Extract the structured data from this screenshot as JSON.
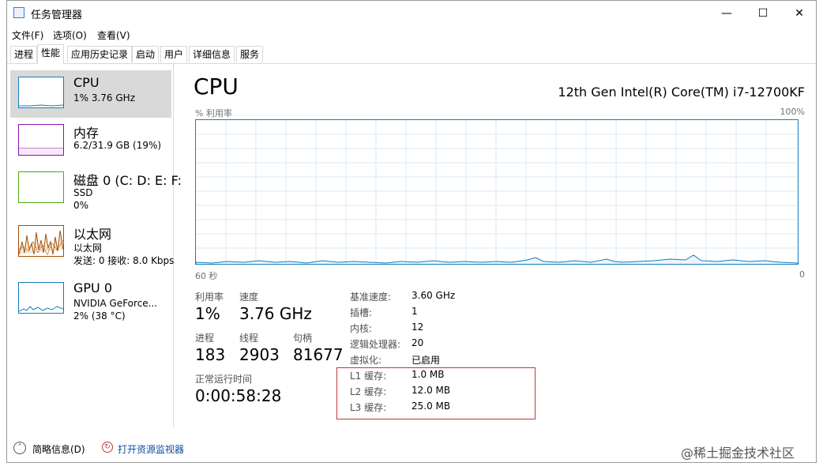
{
  "window": {
    "title": "任务管理器",
    "controls": {
      "minimize": "—",
      "maximize": "☐",
      "close": "✕"
    }
  },
  "menu": [
    "文件(F)",
    "选项(O)",
    "查看(V)"
  ],
  "tabs": [
    "进程",
    "性能",
    "应用历史记录",
    "启动",
    "用户",
    "详细信息",
    "服务"
  ],
  "sidebar": [
    {
      "title": "CPU",
      "line1": "1%  3.76 GHz",
      "line2": ""
    },
    {
      "title": "内存",
      "line1": "6.2/31.9 GB (19%)",
      "line2": ""
    },
    {
      "title": "磁盘 0 (C: D: E: F:",
      "line1": "SSD",
      "line2": "0%"
    },
    {
      "title": "以太网",
      "line1": "以太网",
      "line2": "发送: 0  接收: 8.0 Kbps"
    },
    {
      "title": "GPU 0",
      "line1": "NVIDIA GeForce...",
      "line2": "2% (38 °C)"
    }
  ],
  "main": {
    "title": "CPU",
    "model": "12th Gen Intel(R) Core(TM) i7-12700KF",
    "graph_label": "% 利用率",
    "graph_max": "100%",
    "graph_time": "60 秒",
    "graph_zero": "0",
    "utilization_label": "利用率",
    "utilization": "1%",
    "speed_label": "速度",
    "speed": "3.76 GHz",
    "processes_label": "进程",
    "processes": "183",
    "threads_label": "线程",
    "threads": "2903",
    "handles_label": "句柄",
    "handles": "81677",
    "uptime_label": "正常运行时间",
    "uptime": "0:00:58:28",
    "specs": [
      {
        "label": "基准速度:",
        "value": "3.60 GHz"
      },
      {
        "label": "插槽:",
        "value": "1"
      },
      {
        "label": "内核:",
        "value": "12"
      },
      {
        "label": "逻辑处理器:",
        "value": "20"
      },
      {
        "label": "虚拟化:",
        "value": "已启用"
      },
      {
        "label": "L1 缓存:",
        "value": "1.0 MB"
      },
      {
        "label": "L2 缓存:",
        "value": "12.0 MB"
      },
      {
        "label": "L3 缓存:",
        "value": "25.0 MB"
      }
    ]
  },
  "bottom": {
    "summary": "简略信息(D)",
    "resmon": "打开资源监视器"
  },
  "watermark": "@稀土掘金技术社区",
  "colors": {
    "cpu": "#117dbb",
    "memory": "#8b12ae",
    "disk": "#4da60c",
    "ethernet": "#a74f01",
    "gpu": "#117dbb",
    "highlight": "#c0393b"
  }
}
